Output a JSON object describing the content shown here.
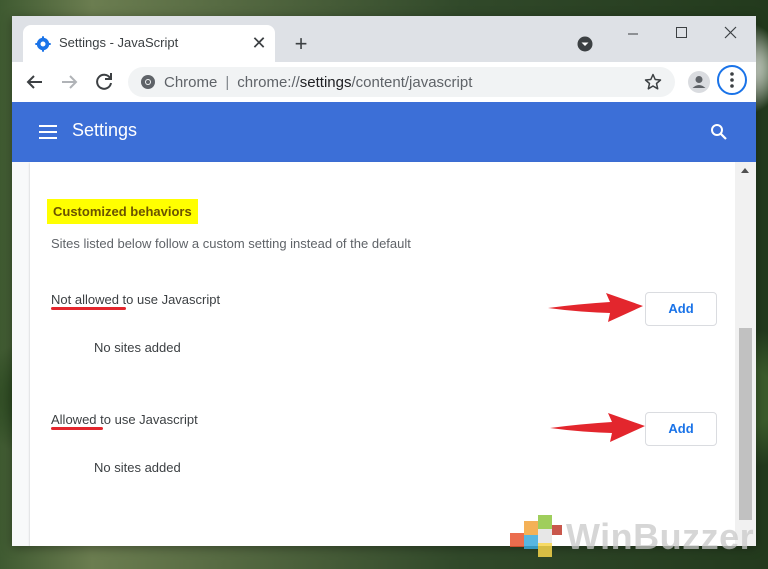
{
  "browser": {
    "tab": {
      "title": "Settings - JavaScript",
      "favicon": "settings-gear-icon"
    },
    "omnibox": {
      "site_label": "Chrome",
      "separator": "|",
      "url_prefix": "chrome://",
      "url_host": "settings",
      "url_path": "/content/javascript"
    }
  },
  "settings": {
    "header_title": "Settings",
    "section": {
      "title": "Customized behaviors",
      "description": "Sites listed below follow a custom setting instead of the default",
      "rows": [
        {
          "label_emphasis": "Not allowed",
          "label_rest": " to use Javascript",
          "add_label": "Add",
          "empty_text": "No sites added"
        },
        {
          "label_emphasis": "Allowed",
          "label_rest": " to use Javascript",
          "add_label": "Add",
          "empty_text": "No sites added"
        }
      ]
    }
  },
  "watermark": {
    "text": "WinBuzzer"
  },
  "colors": {
    "header_blue": "#3c6fd7",
    "link_blue": "#1a73e8",
    "highlight_yellow": "#ffff00",
    "annotation_red": "#e3262d"
  }
}
